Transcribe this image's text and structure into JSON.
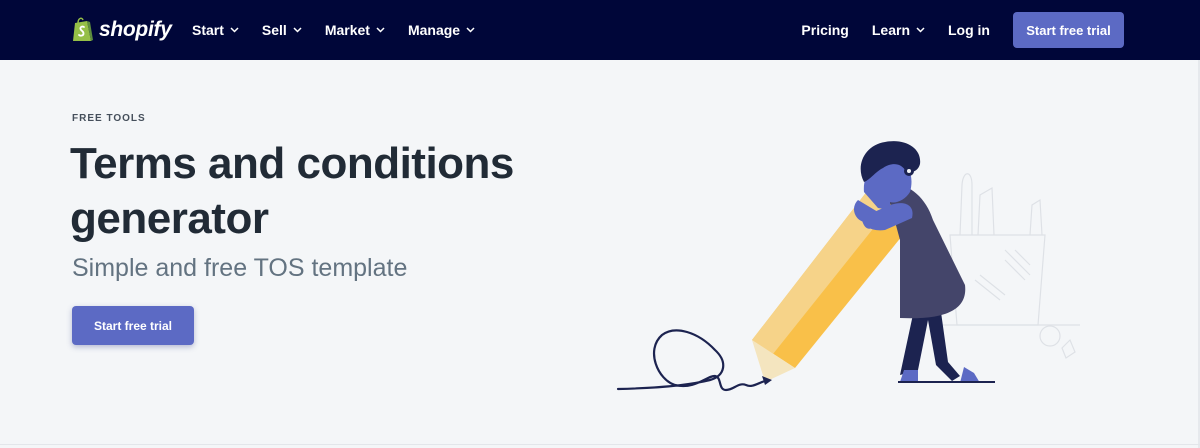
{
  "nav": {
    "brand": "shopify",
    "left_items": [
      {
        "label": "Start"
      },
      {
        "label": "Sell"
      },
      {
        "label": "Market"
      },
      {
        "label": "Manage"
      }
    ],
    "pricing": "Pricing",
    "learn": "Learn",
    "login": "Log in",
    "cta": "Start free trial"
  },
  "hero": {
    "eyebrow": "FREE TOOLS",
    "title": "Terms and conditions generator",
    "subtitle": "Simple and free TOS template",
    "cta": "Start free trial"
  },
  "colors": {
    "nav_bg": "#000639",
    "accent": "#5c6ac4",
    "page_bg": "#f4f6f8",
    "pencil": "#f9c049",
    "figure_dress": "#44456a",
    "figure_skin": "#5c6ac4"
  },
  "icons": {
    "logo": "shopify-bag-icon",
    "dropdown": "chevron-down-icon"
  }
}
